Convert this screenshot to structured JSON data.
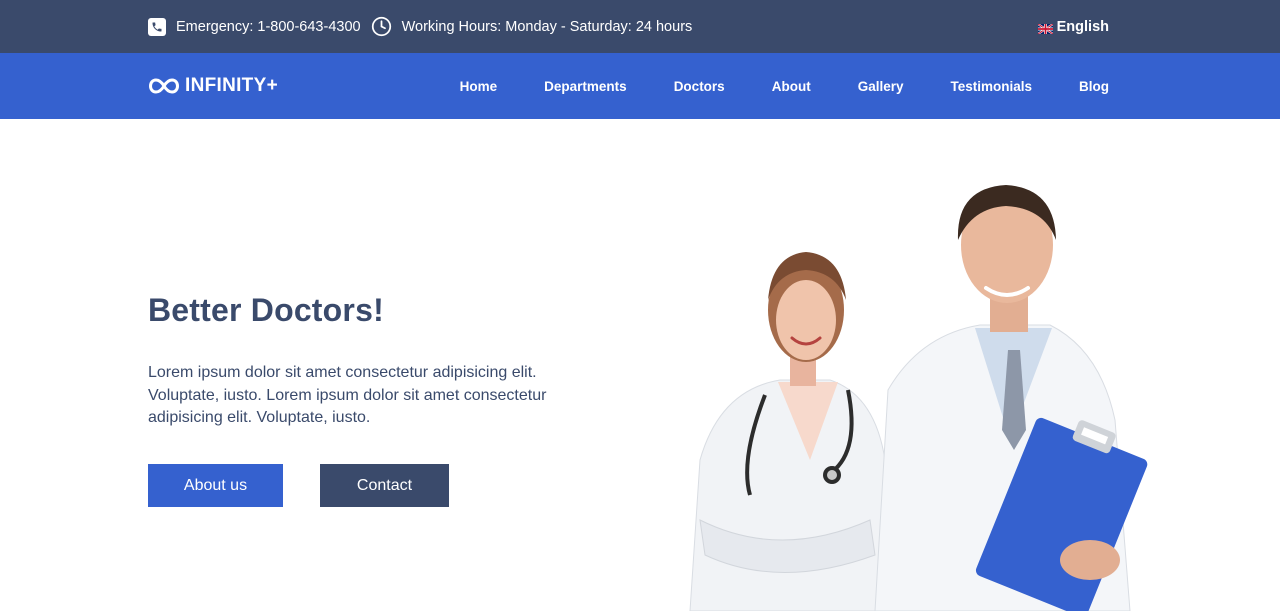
{
  "topbar": {
    "emergency": "Emergency: 1-800-643-4300",
    "hours": "Working Hours: Monday - Saturday: 24 hours",
    "language": "English",
    "icons": {
      "phone": "phone-icon",
      "clock": "clock-icon",
      "flag": "uk-flag-icon"
    }
  },
  "navbar": {
    "logo": "INFINITY+",
    "items": [
      "Home",
      "Departments",
      "Doctors",
      "About",
      "Gallery",
      "Testimonials",
      "Blog"
    ]
  },
  "hero": {
    "title": "Better Doctors!",
    "text": "Lorem ipsum dolor sit amet consectetur adipisicing elit. Voluptate, iusto. Lorem ipsum dolor sit amet consectetur adipisicing elit. Voluptate, iusto.",
    "buttons": {
      "about": "About us",
      "contact": "Contact"
    }
  },
  "colors": {
    "topbar": "#3a4a6b",
    "navbar": "#3561cf",
    "primary_button": "#3561cf",
    "secondary_button": "#3a4a6b",
    "heading": "#3a4a6b"
  }
}
